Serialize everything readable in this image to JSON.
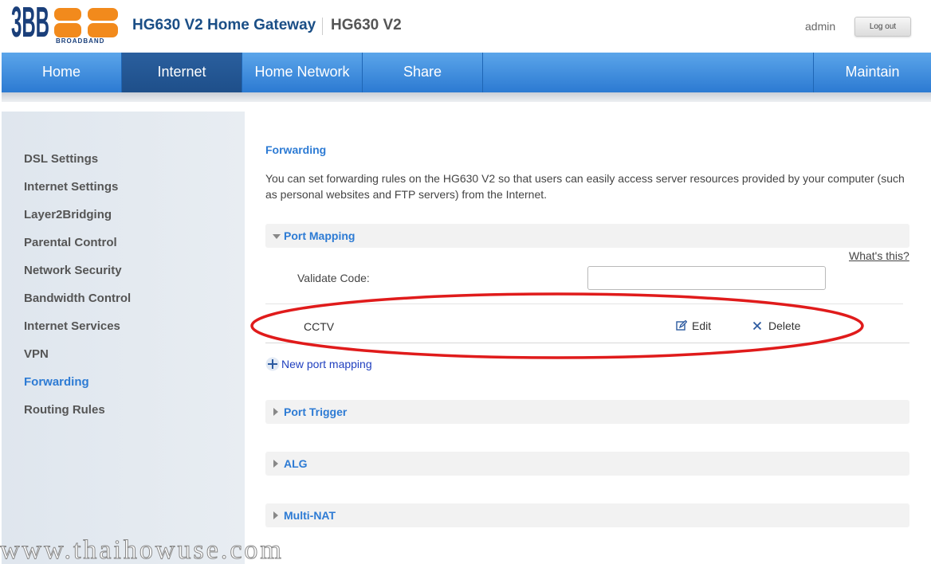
{
  "brand": {
    "logo_alt": "3BB BROADBAND",
    "logo_main": "3BB",
    "logo_sub": "BROADBAND",
    "product_title": "HG630 V2 Home Gateway",
    "model_title": "HG630 V2",
    "accent_color": "#2d7bd4",
    "logo_orange": "#f28a1c",
    "logo_navy": "#1a3f7a"
  },
  "user": {
    "name": "admin",
    "logout_label": "Log out"
  },
  "nav": {
    "items": [
      {
        "label": "Home"
      },
      {
        "label": "Internet"
      },
      {
        "label": "Home Network"
      },
      {
        "label": "Share"
      },
      {
        "label": "Maintain"
      }
    ],
    "active": "Internet"
  },
  "sidebar": {
    "items": [
      {
        "label": "DSL Settings"
      },
      {
        "label": "Internet Settings"
      },
      {
        "label": "Layer2Bridging"
      },
      {
        "label": "Parental Control"
      },
      {
        "label": "Network Security"
      },
      {
        "label": "Bandwidth Control"
      },
      {
        "label": "Internet Services"
      },
      {
        "label": "VPN"
      },
      {
        "label": "Forwarding"
      },
      {
        "label": "Routing Rules"
      }
    ],
    "active": "Forwarding"
  },
  "main": {
    "title": "Forwarding",
    "description": "You can set forwarding rules on the HG630 V2 so that users can easily access server resources provided by your computer (such as personal websites and FTP servers) from the Internet.",
    "port_mapping": {
      "label": "Port Mapping",
      "expanded": true,
      "whats_this": "What's this?",
      "validate_label": "Validate Code:",
      "validate_value": "",
      "rules": [
        {
          "name": "CCTV",
          "edit_label": "Edit",
          "delete_label": "Delete"
        }
      ],
      "new_label": "New port mapping"
    },
    "sections": [
      {
        "label": "Port Trigger",
        "expanded": false
      },
      {
        "label": "ALG",
        "expanded": false
      },
      {
        "label": "Multi-NAT",
        "expanded": false
      }
    ]
  },
  "watermark": "www.thaihowuse.com"
}
